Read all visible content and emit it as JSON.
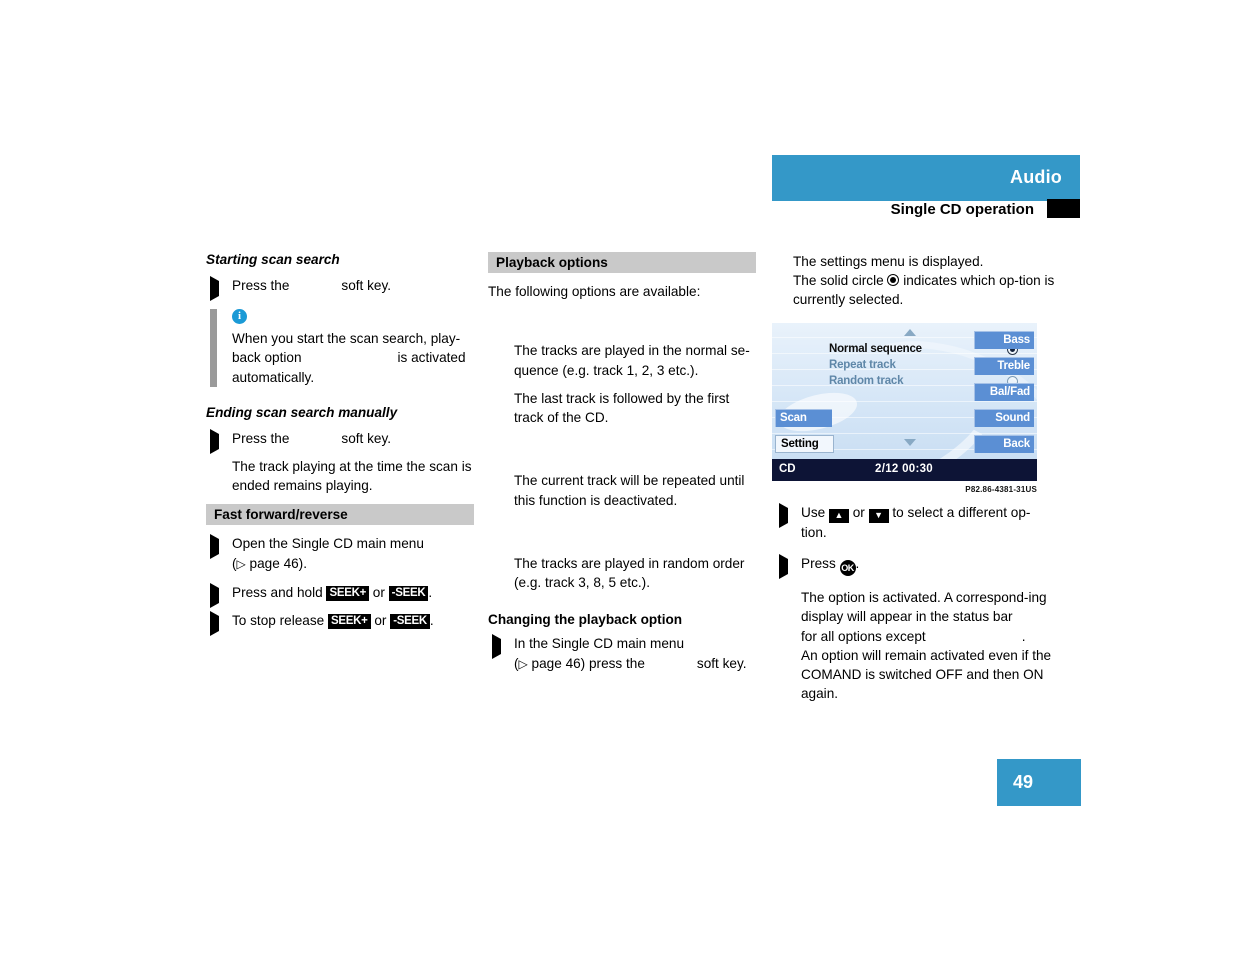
{
  "header": {
    "title": "Audio",
    "subtitle": "Single CD operation",
    "band_color": "#3498c8"
  },
  "page_number": "49",
  "figure_caption": "P82.86-4381-31US",
  "column_left": {
    "heading_1": "Starting scan search",
    "step_1_pre": "Press the",
    "step_1_post": "soft key.",
    "note": {
      "icon": "info-icon",
      "text_1": "When you start the scan search, play-",
      "text_2_pre": "back option",
      "text_2_post": "is activated",
      "text_3": "automatically."
    },
    "heading_2": "Ending scan search manually",
    "step_2_pre": "Press the",
    "step_2_post": "soft key.",
    "result_2": "The track playing at the time the scan is ended remains playing.",
    "heading_3": "Fast forward/reverse",
    "step_3_line1": "Open the Single CD main menu",
    "step_3_line2_pre": "(",
    "step_3_line2_ref": "page 46).",
    "step_4_pre": "Press and hold",
    "step_4_key_a": "SEEK+",
    "step_4_or": "or",
    "step_4_key_b": "-SEEK",
    "step_4_post": ".",
    "step_5_pre": "To stop release",
    "step_5_key_a": "SEEK+",
    "step_5_or": "or",
    "step_5_key_b": "-SEEK",
    "step_5_post": "."
  },
  "column_middle": {
    "heading_1": "Playback options",
    "intro": "The following options are available:",
    "bullet_1_desc_1": "The tracks are played in the normal se-quence (e.g. track 1, 2, 3 etc.).",
    "bullet_1_desc_2": "The last track is followed by the first track of the CD.",
    "bullet_2_desc": "The current track will be repeated until this function is deactivated.",
    "bullet_3_desc": "The tracks are played in random order (e.g. track 3, 8, 5 etc.).",
    "heading_2": "Changing the playback option",
    "step_1_line1": "In the Single CD main menu",
    "step_1_line2_ref": "page 46) press the",
    "step_1_line2_post": "soft key."
  },
  "column_right": {
    "intro_1": "The settings menu is displayed.",
    "intro_2_pre": "The solid circle",
    "intro_2_post": "indicates which op-tion is currently selected.",
    "step_1_pre": "Use",
    "step_1_mid": "or",
    "step_1_post": "to select a different op-tion.",
    "step_1_key_up": "up-arrow-key",
    "step_1_key_down": "down-arrow-key",
    "step_2_pre": "Press",
    "step_2_key": "OK",
    "step_2_post": ".",
    "result_1": "The option is activated. A correspond-ing display will appear in the status bar",
    "result_2_pre": "for all options except",
    "result_2_post": ".",
    "result_3": "An option will remain activated even if the COMAND is switched OFF and then ON again."
  },
  "comand_screen": {
    "options": [
      {
        "label": "Normal sequence",
        "selected": true
      },
      {
        "label": "Repeat track",
        "selected": false
      },
      {
        "label": "Random track",
        "selected": false
      }
    ],
    "left_softkeys": [
      {
        "label": "Scan",
        "state": "normal"
      },
      {
        "label": "Setting",
        "state": "highlighted"
      }
    ],
    "right_softkeys": [
      "Bass",
      "Treble",
      "Bal/Fad",
      "Sound",
      "Back"
    ],
    "status_source": "CD",
    "status_track": "2/12  00:30",
    "scroll_up": "scroll-up-arrow",
    "scroll_down": "scroll-down-arrow",
    "accent_blue": "#5b8fd4",
    "status_bg": "#0d1436"
  }
}
